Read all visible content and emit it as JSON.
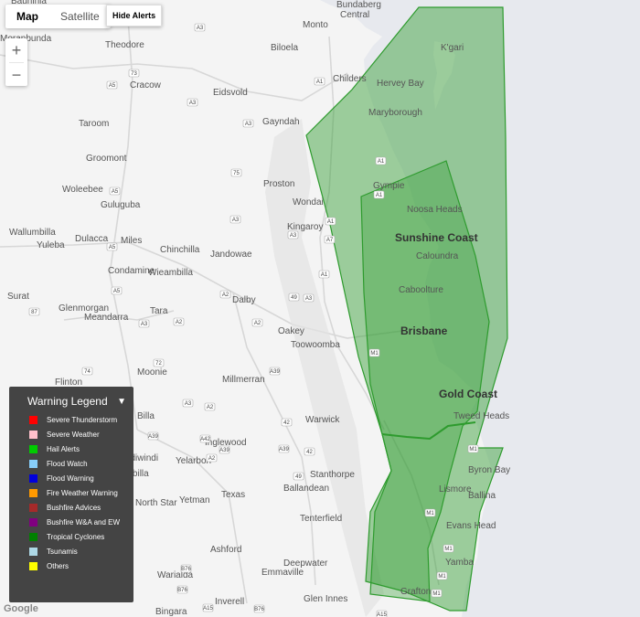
{
  "map_type": {
    "map_label": "Map",
    "satellite_label": "Satellite"
  },
  "hide_alerts_label": "Hide Alerts",
  "zoom": {
    "in_label": "+",
    "out_label": "−"
  },
  "places": [
    {
      "name": "Bauhinia",
      "cls": "place"
    },
    {
      "name": "Bundaberg",
      "cls": "place"
    },
    {
      "name": "Central",
      "cls": "place"
    },
    {
      "name": "K'gari",
      "cls": "place"
    },
    {
      "name": "Monto",
      "cls": "place"
    },
    {
      "name": "Moranbunda",
      "cls": "place"
    },
    {
      "name": "Theodore",
      "cls": "place"
    },
    {
      "name": "Biloela",
      "cls": "place"
    },
    {
      "name": "Childers",
      "cls": "place"
    },
    {
      "name": "Hervey Bay",
      "cls": "place"
    },
    {
      "name": "Cracow",
      "cls": "place"
    },
    {
      "name": "Eidsvold",
      "cls": "place"
    },
    {
      "name": "Maryborough",
      "cls": "place"
    },
    {
      "name": "Taroom",
      "cls": "place"
    },
    {
      "name": "Gayndah",
      "cls": "place"
    },
    {
      "name": "Groomont",
      "cls": "place"
    },
    {
      "name": "Proston",
      "cls": "place"
    },
    {
      "name": "Gympie",
      "cls": "place"
    },
    {
      "name": "Woleebee",
      "cls": "place"
    },
    {
      "name": "Guluguba",
      "cls": "place"
    },
    {
      "name": "Wondai",
      "cls": "place"
    },
    {
      "name": "Noosa Heads",
      "cls": "place"
    },
    {
      "name": "Kingaroy",
      "cls": "place"
    },
    {
      "name": "Wallumbilla",
      "cls": "place"
    },
    {
      "name": "Dulacca",
      "cls": "place"
    },
    {
      "name": "Sunshine Coast",
      "cls": "city"
    },
    {
      "name": "Yuleba",
      "cls": "place"
    },
    {
      "name": "Miles",
      "cls": "place"
    },
    {
      "name": "Chinchilla",
      "cls": "place"
    },
    {
      "name": "Jandowae",
      "cls": "place"
    },
    {
      "name": "Caloundra",
      "cls": "place"
    },
    {
      "name": "Condamine",
      "cls": "place"
    },
    {
      "name": "Wieambilla",
      "cls": "place"
    },
    {
      "name": "Caboolture",
      "cls": "place"
    },
    {
      "name": "Surat",
      "cls": "place"
    },
    {
      "name": "Dalby",
      "cls": "place"
    },
    {
      "name": "Glenmorgan",
      "cls": "place"
    },
    {
      "name": "Tara",
      "cls": "place"
    },
    {
      "name": "Meandarra",
      "cls": "place"
    },
    {
      "name": "Brisbane",
      "cls": "city"
    },
    {
      "name": "Oakey",
      "cls": "place"
    },
    {
      "name": "Toowoomba",
      "cls": "place"
    },
    {
      "name": "Moonie",
      "cls": "place"
    },
    {
      "name": "Millmerran",
      "cls": "place"
    },
    {
      "name": "Flinton",
      "cls": "place"
    },
    {
      "name": "Gold Coast",
      "cls": "city"
    },
    {
      "name": "Tweed Heads",
      "cls": "place"
    },
    {
      "name": "Warwick",
      "cls": "place"
    },
    {
      "name": "Billa",
      "cls": "place"
    },
    {
      "name": "Inglewood",
      "cls": "place"
    },
    {
      "name": "Goondiwindi",
      "cls": "place"
    },
    {
      "name": "Yelarbon",
      "cls": "place"
    },
    {
      "name": "Byron Bay",
      "cls": "place"
    },
    {
      "name": "Boggabilla",
      "cls": "place"
    },
    {
      "name": "Stanthorpe",
      "cls": "place"
    },
    {
      "name": "Ballandean",
      "cls": "place"
    },
    {
      "name": "Lismore",
      "cls": "place"
    },
    {
      "name": "Ballina",
      "cls": "place"
    },
    {
      "name": "North Star",
      "cls": "place"
    },
    {
      "name": "Yetman",
      "cls": "place"
    },
    {
      "name": "Texas",
      "cls": "place"
    },
    {
      "name": "Tenterfield",
      "cls": "place"
    },
    {
      "name": "Evans Head",
      "cls": "place"
    },
    {
      "name": "Ashford",
      "cls": "place"
    },
    {
      "name": "Deepwater",
      "cls": "place"
    },
    {
      "name": "Emmaville",
      "cls": "place"
    },
    {
      "name": "Yamba",
      "cls": "place"
    },
    {
      "name": "Warialda",
      "cls": "place"
    },
    {
      "name": "Glen Innes",
      "cls": "place"
    },
    {
      "name": "Inverell",
      "cls": "place"
    },
    {
      "name": "Grafton",
      "cls": "place"
    },
    {
      "name": "Bingara",
      "cls": "place"
    }
  ],
  "shields": [
    "A3",
    "A1",
    "A5",
    "73",
    "A3",
    "A3",
    "A5",
    "A1",
    "A1",
    "75",
    "A1",
    "A5",
    "A3",
    "A3",
    "A1",
    "A5",
    "A2",
    "49",
    "A3",
    "A7",
    "A2",
    "A3",
    "M1",
    "A2",
    "87",
    "72",
    "A2",
    "A2",
    "A3",
    "49",
    "A39",
    "74",
    "A39",
    "42",
    "42",
    "A39",
    "A42",
    "A39",
    "M1",
    "M1",
    "M1",
    "M1",
    "M1",
    "A15",
    "B76",
    "B76",
    "A15",
    "B76"
  ],
  "warning_areas_color": "#2e9b2e",
  "legend": {
    "title": "Warning Legend",
    "items": [
      {
        "label": "Severe Thunderstorm",
        "color": "#ff0000"
      },
      {
        "label": "Severe Weather",
        "color": "#ffc0cb"
      },
      {
        "label": "Hail Alerts",
        "color": "#00cc00"
      },
      {
        "label": "Flood Watch",
        "color": "#87cefa"
      },
      {
        "label": "Flood Warning",
        "color": "#0000dd"
      },
      {
        "label": "Fire Weather Warning",
        "color": "#ff9900"
      },
      {
        "label": "Bushfire Advices",
        "color": "#a52a2a"
      },
      {
        "label": "Bushfire W&A and EW",
        "color": "#800080"
      },
      {
        "label": "Tropical Cyclones",
        "color": "#008000"
      },
      {
        "label": "Tsunamis",
        "color": "#add8e6"
      },
      {
        "label": "Others",
        "color": "#ffff00"
      }
    ]
  },
  "google_label": "Google"
}
